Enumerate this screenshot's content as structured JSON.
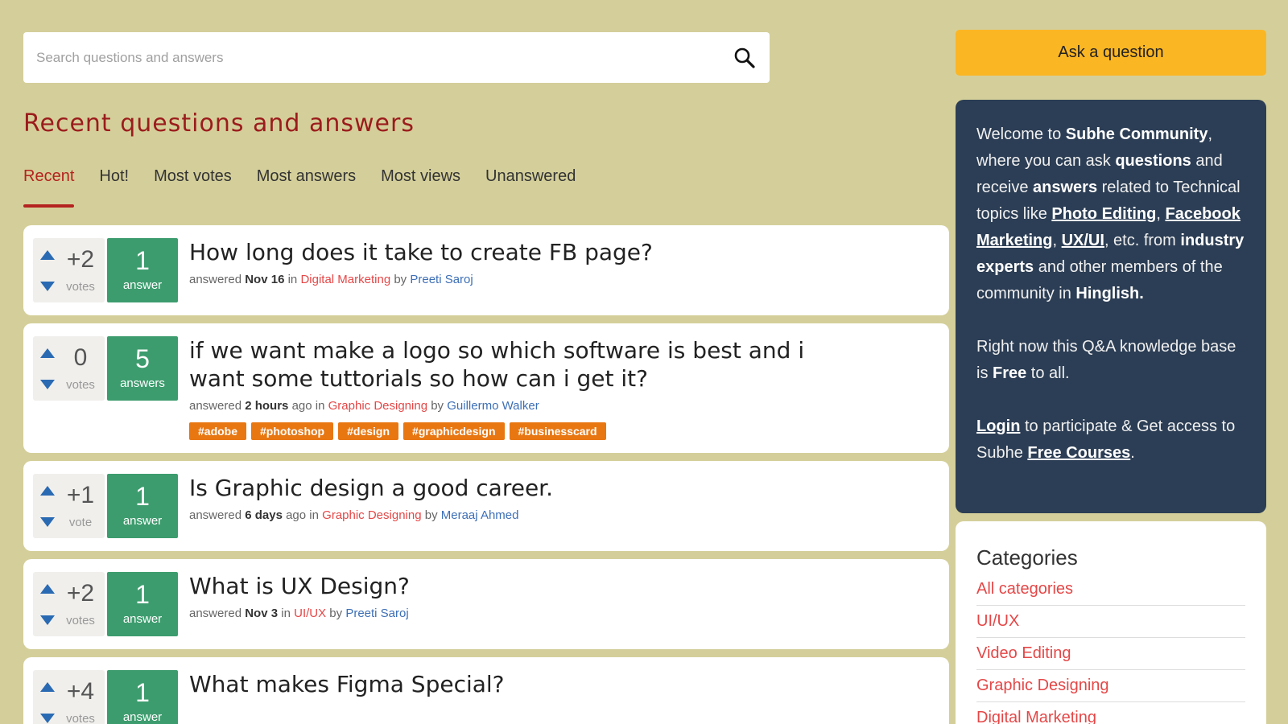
{
  "search": {
    "placeholder": "Search questions and answers",
    "icon": "search-icon"
  },
  "page_title": "Recent questions and answers",
  "tabs": [
    {
      "label": "Recent",
      "active": true
    },
    {
      "label": "Hot!",
      "active": false
    },
    {
      "label": "Most votes",
      "active": false
    },
    {
      "label": "Most answers",
      "active": false
    },
    {
      "label": "Most views",
      "active": false
    },
    {
      "label": "Unanswered",
      "active": false
    }
  ],
  "questions": [
    {
      "votes": "+2",
      "votes_label": "votes",
      "answers": "1",
      "answers_label": "answer",
      "title": "How long does it take to create FB page?",
      "meta_prefix": "answered",
      "when": "Nov 16",
      "when_suffix": "",
      "in": "in",
      "category": "Digital Marketing",
      "by": "by",
      "user": "Preeti Saroj",
      "tags": []
    },
    {
      "votes": "0",
      "votes_label": "votes",
      "answers": "5",
      "answers_label": "answers",
      "title": "if we want make a logo so which software is best and i want some tuttorials so how can i get it?",
      "meta_prefix": "answered",
      "when": "2 hours",
      "when_suffix": "ago",
      "in": "in",
      "category": "Graphic Designing",
      "by": "by",
      "user": "Guillermo Walker",
      "tags": [
        "#adobe",
        "#photoshop",
        "#design",
        "#graphicdesign",
        "#businesscard"
      ]
    },
    {
      "votes": "+1",
      "votes_label": "vote",
      "answers": "1",
      "answers_label": "answer",
      "title": "Is Graphic design a good career.",
      "meta_prefix": "answered",
      "when": "6 days",
      "when_suffix": "ago",
      "in": "in",
      "category": "Graphic Designing",
      "by": "by",
      "user": "Meraaj Ahmed",
      "tags": []
    },
    {
      "votes": "+2",
      "votes_label": "votes",
      "answers": "1",
      "answers_label": "answer",
      "title": "What is UX Design?",
      "meta_prefix": "answered",
      "when": "Nov 3",
      "when_suffix": "",
      "in": "in",
      "category": "UI/UX",
      "by": "by",
      "user": "Preeti Saroj",
      "tags": []
    },
    {
      "votes": "+4",
      "votes_label": "votes",
      "answers": "1",
      "answers_label": "answer",
      "title": "What makes Figma Special?",
      "meta_prefix": "",
      "when": "",
      "when_suffix": "",
      "in": "",
      "category": "",
      "by": "",
      "user": "",
      "tags": []
    }
  ],
  "sidebar": {
    "ask_button": "Ask a question",
    "welcome": {
      "t1": "Welcome to ",
      "community": "Subhe Community",
      "t2": ", where you can ask ",
      "questions": "questions",
      "t3": " and receive ",
      "answers": "answers",
      "t4": " related to Technical topics like ",
      "topic1": "Photo Editing",
      "t5": ", ",
      "topic2": "Facebook Marketing",
      "t6": ", ",
      "topic3": "UX/UI",
      "t7": ", etc. from ",
      "experts": "industry experts",
      "t8": " and other members of the community in ",
      "language": "Hinglish.",
      "p2a": "Right now this Q&A knowledge base is ",
      "free": "Free",
      "p2b": " to all.",
      "login": "Login",
      "p3a": " to participate & Get access to Subhe ",
      "courses": "Free Courses",
      "p3b": "."
    },
    "categories": {
      "title": "Categories",
      "items": [
        "All categories",
        "UI/UX",
        "Video Editing",
        "Graphic Designing",
        "Digital Marketing"
      ]
    }
  },
  "colors": {
    "background": "#d4cf9a",
    "accent_red": "#b4231f",
    "answer_green": "#3d9c6e",
    "tag_orange": "#e87712",
    "ask_yellow": "#fbb624",
    "welcome_bg": "#2c3e55",
    "link_blue": "#3d6fb6"
  }
}
